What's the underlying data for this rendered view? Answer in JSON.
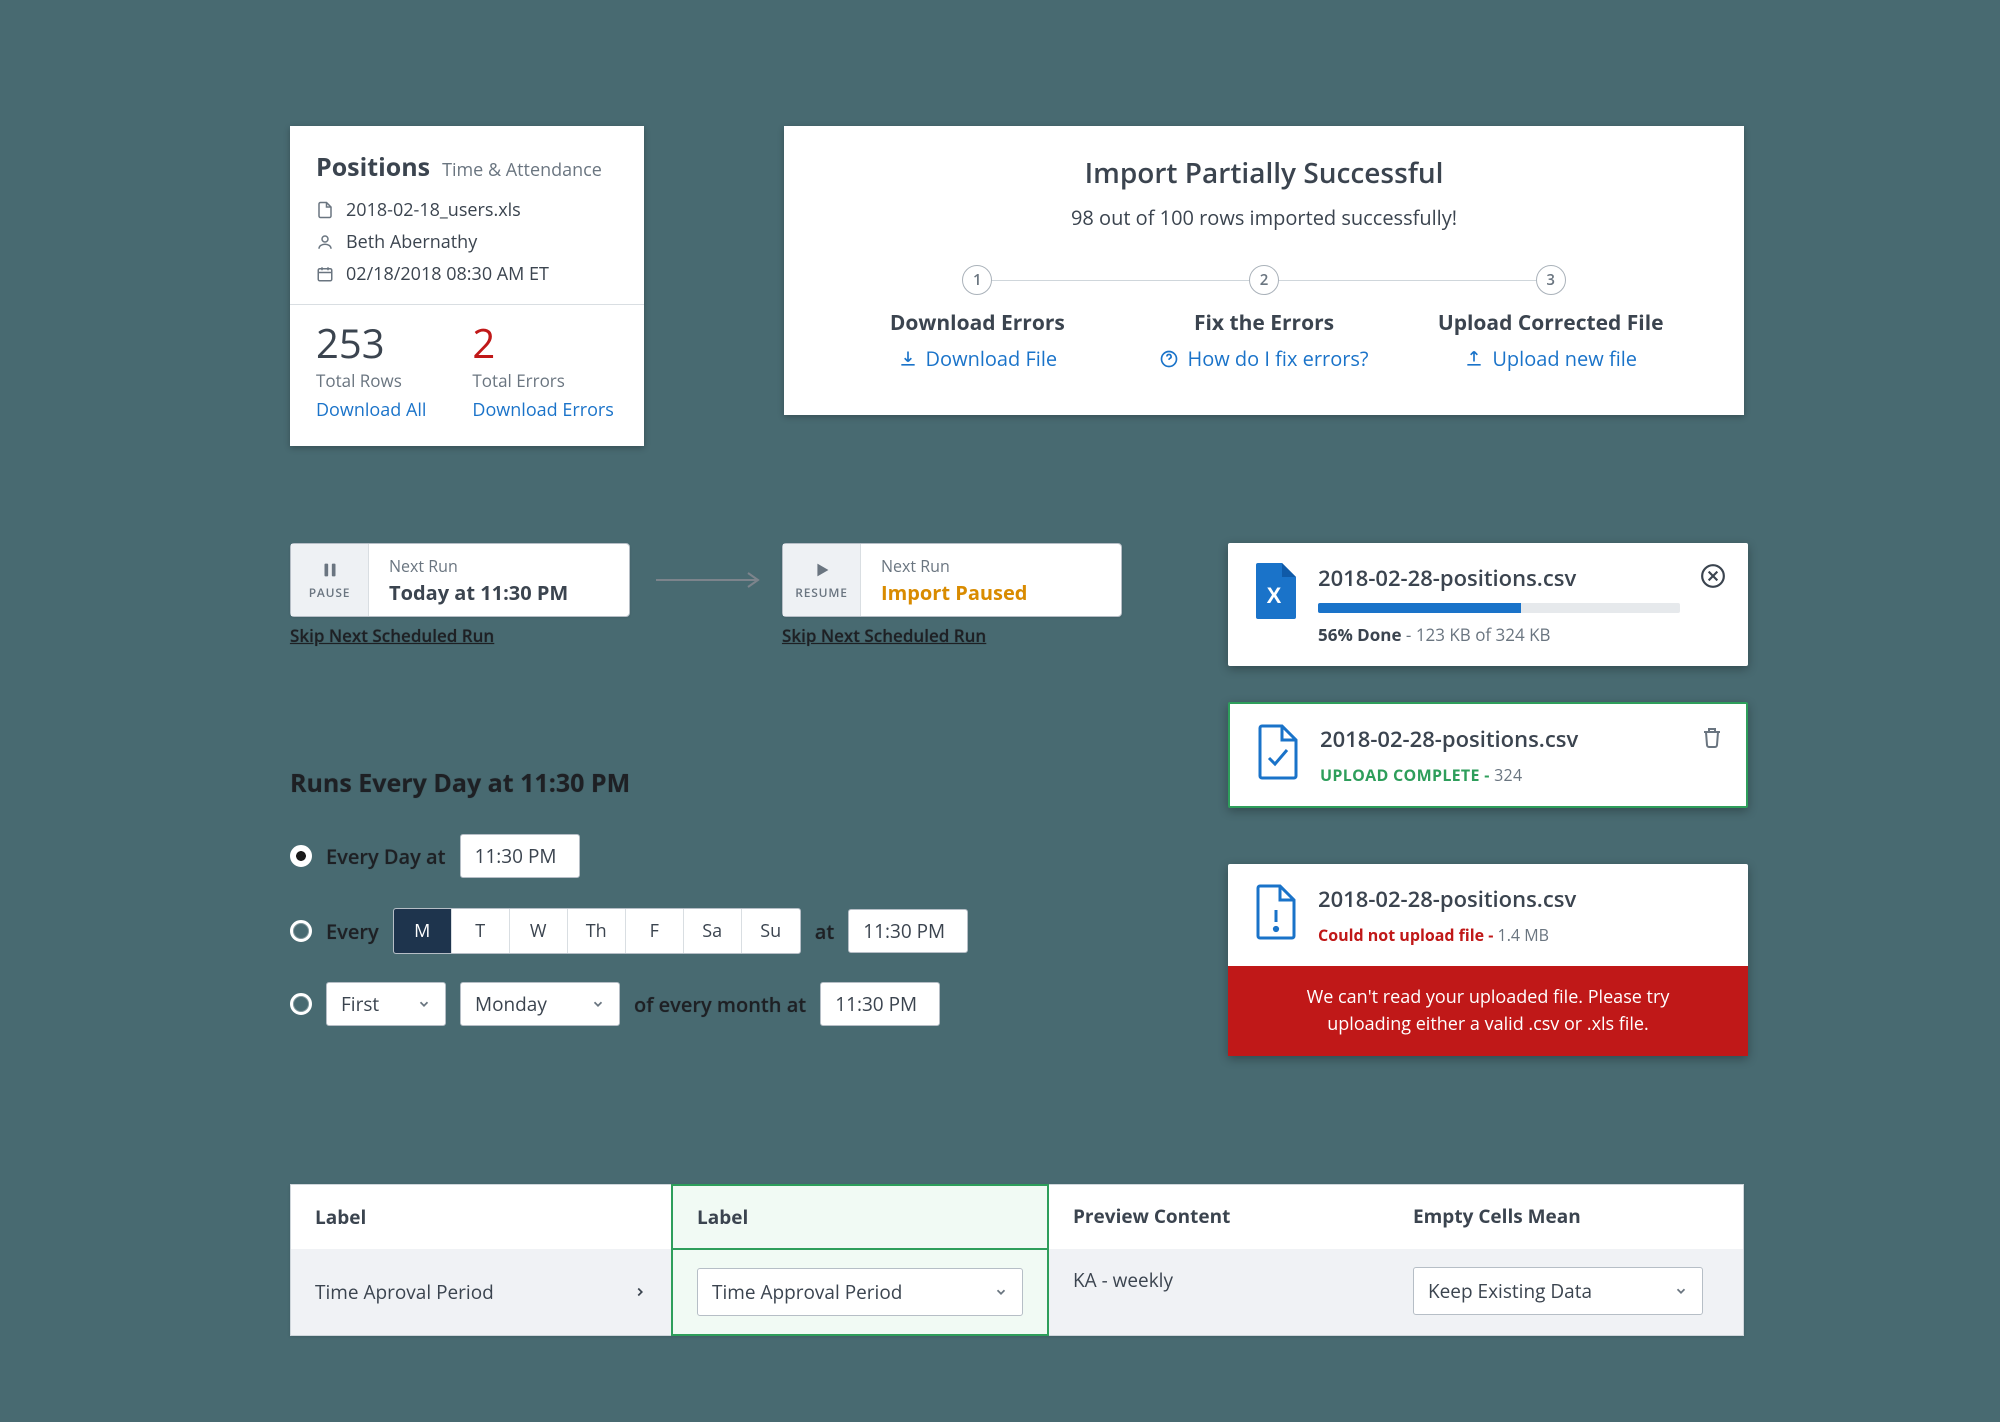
{
  "positions": {
    "title": "Positions",
    "subtitle": "Time & Attendance",
    "file": "2018-02-18_users.xls",
    "user": "Beth Abernathy",
    "datetime": "02/18/2018 08:30 AM ET",
    "total_rows": "253",
    "total_rows_label": "Total Rows",
    "download_all": "Download All",
    "total_errors": "2",
    "total_errors_label": "Total Errors",
    "download_errors": "Download Errors"
  },
  "import": {
    "title": "Import Partially Successful",
    "subtext": "98 out of 100 rows imported successfully!",
    "steps": [
      {
        "num": "1",
        "label": "Download Errors",
        "action": "Download File"
      },
      {
        "num": "2",
        "label": "Fix the Errors",
        "action": "How do I fix errors?"
      },
      {
        "num": "3",
        "label": "Upload Corrected File",
        "action": "Upload new file"
      }
    ]
  },
  "run_pause": {
    "btn": "PAUSE",
    "small": "Next Run",
    "big": "Today at 11:30 PM",
    "skip": "Skip Next Scheduled Run"
  },
  "run_resume": {
    "btn": "RESUME",
    "small": "Next Run",
    "big": "Import Paused",
    "skip": "Skip Next Scheduled Run"
  },
  "schedule": {
    "heading": "Runs Every Day at 11:30 PM",
    "opt1_label": "Every Day at",
    "opt1_time": "11:30 PM",
    "opt2_label_pre": "Every",
    "opt2_days": [
      "M",
      "T",
      "W",
      "Th",
      "F",
      "Sa",
      "Su"
    ],
    "opt2_active_index": 0,
    "opt2_label_post": "at",
    "opt2_time": "11:30 PM",
    "opt3_ordinal": "First",
    "opt3_day": "Monday",
    "opt3_label": "of every month at",
    "opt3_time": "11:30 PM"
  },
  "uploads": {
    "progress": {
      "name": "2018-02-28-positions.csv",
      "pct_text": "56% Done",
      "pct_value": 56,
      "size_text": "123 KB of 324 KB"
    },
    "complete": {
      "name": "2018-02-28-positions.csv",
      "status": "UPLOAD COMPLETE - ",
      "size": "324"
    },
    "error": {
      "name": "2018-02-28-positions.csv",
      "status": "Could not upload file - ",
      "size": "1.4 MB",
      "banner": "We can't read your uploaded file. Please try uploading either a valid .csv or .xls file."
    }
  },
  "mapping": {
    "headers": [
      "Label",
      "Label",
      "Preview Content",
      "Empty Cells Mean"
    ],
    "source": "Time Aproval Period",
    "mapped": "Time Approval Period",
    "preview": "KA - weekly",
    "empty": "Keep Existing Data"
  }
}
